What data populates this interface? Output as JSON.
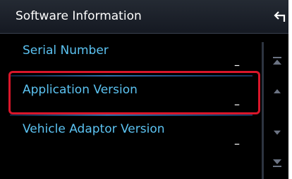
{
  "header": {
    "title": "Software Information",
    "back_icon": "back-arrow-icon"
  },
  "list": {
    "items": [
      {
        "label": "Serial Number",
        "value": "–"
      },
      {
        "label": "Application Version",
        "value": "–",
        "selected": true
      },
      {
        "label": "Vehicle Adaptor Version",
        "value": "–"
      }
    ]
  },
  "scrollbar": {
    "icons": [
      "scroll-to-top-icon",
      "scroll-up-icon",
      "scroll-down-icon",
      "scroll-to-bottom-icon"
    ]
  },
  "colors": {
    "background": "#000000",
    "label": "#5cc3f2",
    "title": "#ffffff",
    "highlight": "#d9162a",
    "separator": "#2e6fae"
  }
}
